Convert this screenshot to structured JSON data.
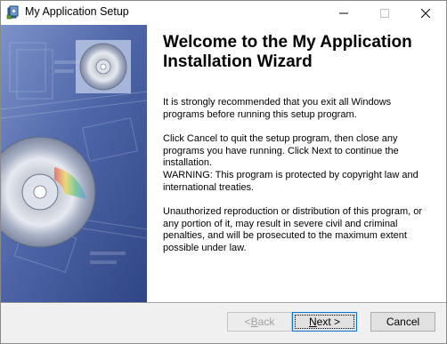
{
  "window": {
    "title": "My Application Setup"
  },
  "welcome": {
    "heading": "Welcome to the My Application Installation Wizard",
    "paragraphs": [
      "It is strongly recommended that you exit all Windows programs before running this setup program.",
      "Click Cancel to quit the setup program, then close any programs you have running.  Click Next to continue the installation.",
      "WARNING: This program is protected by copyright law and international treaties.",
      "Unauthorized reproduction or distribution of this program, or any portion of it, may result in severe civil and criminal penalties, and will be prosecuted to the maximum extent possible under law."
    ]
  },
  "buttons": {
    "back": {
      "mnemonic": "B",
      "rest": "ack",
      "prefix": "< ",
      "enabled": false
    },
    "next": {
      "mnemonic": "N",
      "rest": "ext >",
      "focused": true
    },
    "cancel": {
      "label": "Cancel"
    }
  },
  "colors": {
    "side_panel_base": "#4a5f9e",
    "accent_focus": "#0078d7"
  },
  "icons": {
    "app": "setup-icon",
    "minimize": "minimize-icon",
    "maximize": "maximize-icon",
    "close": "close-icon",
    "banner_cd": "cd-disc-icon"
  }
}
